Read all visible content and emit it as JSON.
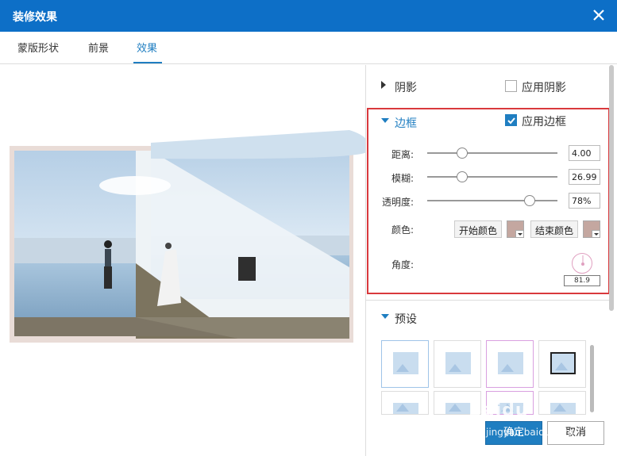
{
  "window": {
    "title": "装修效果"
  },
  "tabs": [
    {
      "label": "蒙版形状"
    },
    {
      "label": "前景"
    },
    {
      "label": "效果"
    }
  ],
  "shadow": {
    "label": "阴影",
    "apply_label": "应用阴影",
    "checked": false
  },
  "border": {
    "label": "边框",
    "apply_label": "应用边框",
    "checked": true,
    "distance": {
      "label": "距离:",
      "value": "4.00"
    },
    "blur": {
      "label": "模糊:",
      "value": "26.99"
    },
    "opacity": {
      "label": "透明度:",
      "value": "78%"
    },
    "color": {
      "label": "颜色:",
      "start_label": "开始颜色",
      "end_label": "结束颜色",
      "start_color": "#c4a7a0",
      "end_color": "#c4a7a0"
    },
    "angle": {
      "label": "角度:",
      "value": "81.9"
    }
  },
  "presets": {
    "label": "预设"
  },
  "buttons": {
    "ok": "确定",
    "cancel": "取消"
  },
  "watermark": {
    "brand": "Baidu",
    "sub": "jingyan.baidu.com"
  },
  "colors": {
    "accent": "#1f7ec1",
    "titlebar": "#0d6fc7",
    "highlight": "#d9393c"
  }
}
